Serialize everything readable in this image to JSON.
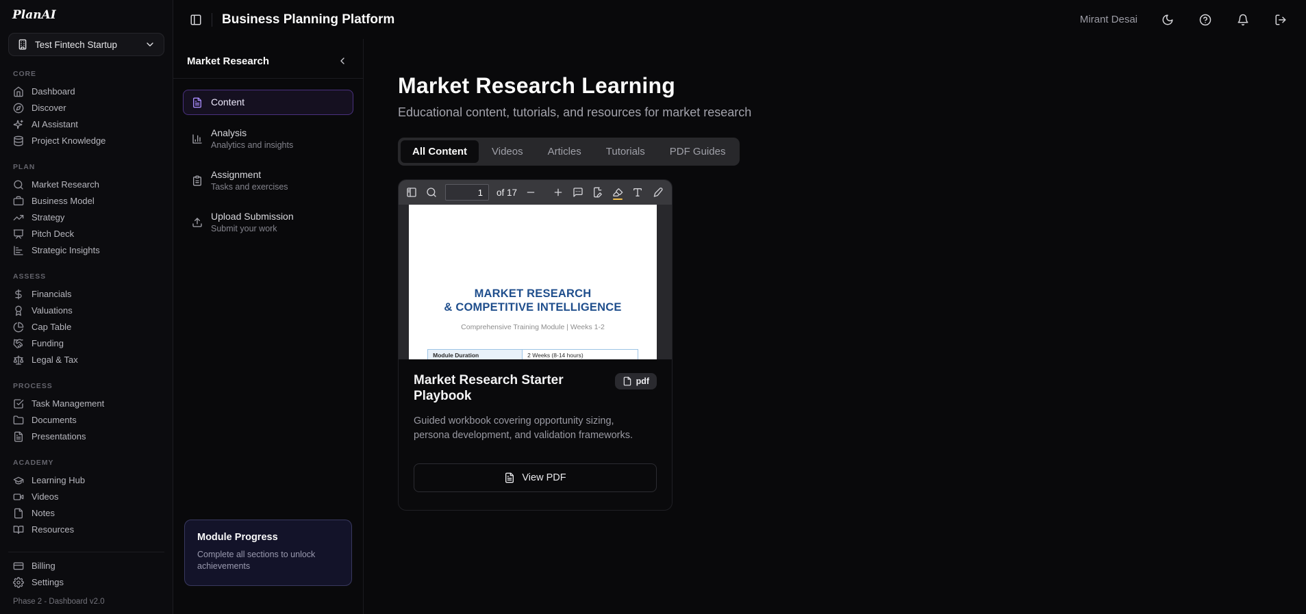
{
  "brand": "PlanAI",
  "workspace": {
    "name": "Test Fintech Startup",
    "icon": "building-icon"
  },
  "sidebar": {
    "sections": [
      {
        "label": "CORE",
        "items": [
          {
            "label": "Dashboard",
            "icon": "home-icon"
          },
          {
            "label": "Discover",
            "icon": "compass-icon"
          },
          {
            "label": "AI Assistant",
            "icon": "sparkles-icon"
          },
          {
            "label": "Project Knowledge",
            "icon": "database-icon"
          }
        ]
      },
      {
        "label": "PLAN",
        "items": [
          {
            "label": "Market Research",
            "icon": "search-icon"
          },
          {
            "label": "Business Model",
            "icon": "briefcase-icon"
          },
          {
            "label": "Strategy",
            "icon": "trending-up-icon"
          },
          {
            "label": "Pitch Deck",
            "icon": "presentation-icon"
          },
          {
            "label": "Strategic Insights",
            "icon": "bar-chart-horizontal-icon"
          }
        ]
      },
      {
        "label": "ASSESS",
        "items": [
          {
            "label": "Financials",
            "icon": "dollar-icon"
          },
          {
            "label": "Valuations",
            "icon": "award-icon"
          },
          {
            "label": "Cap Table",
            "icon": "pie-chart-icon"
          },
          {
            "label": "Funding",
            "icon": "handshake-icon"
          },
          {
            "label": "Legal & Tax",
            "icon": "scale-icon"
          }
        ]
      },
      {
        "label": "PROCESS",
        "items": [
          {
            "label": "Task Management",
            "icon": "check-square-icon"
          },
          {
            "label": "Documents",
            "icon": "folder-icon"
          },
          {
            "label": "Presentations",
            "icon": "file-text-icon"
          }
        ]
      },
      {
        "label": "ACADEMY",
        "items": [
          {
            "label": "Learning Hub",
            "icon": "graduation-cap-icon"
          },
          {
            "label": "Videos",
            "icon": "video-icon"
          },
          {
            "label": "Notes",
            "icon": "file-icon"
          },
          {
            "label": "Resources",
            "icon": "book-open-icon"
          }
        ]
      }
    ],
    "footer_items": [
      {
        "label": "Billing",
        "icon": "credit-card-icon"
      },
      {
        "label": "Settings",
        "icon": "gear-icon"
      }
    ],
    "version": "Phase 2 - Dashboard v2.0"
  },
  "header": {
    "title": "Business Planning Platform",
    "user": "Mirant Desai",
    "icons": [
      "moon-icon",
      "help-circle-icon",
      "bell-icon",
      "logout-icon"
    ]
  },
  "module_panel": {
    "title": "Market Research",
    "items": [
      {
        "label": "Content",
        "sub": "",
        "icon": "file-text-icon",
        "active": true
      },
      {
        "label": "Analysis",
        "sub": "Analytics and insights",
        "icon": "bar-chart-icon",
        "active": false
      },
      {
        "label": "Assignment",
        "sub": "Tasks and exercises",
        "icon": "clipboard-icon",
        "active": false
      },
      {
        "label": "Upload Submission",
        "sub": "Submit your work",
        "icon": "upload-icon",
        "active": false
      }
    ],
    "progress": {
      "title": "Module Progress",
      "subtitle": "Complete all sections to unlock achievements"
    }
  },
  "main": {
    "title": "Market Research Learning",
    "subtitle": "Educational content, tutorials, and resources for market research",
    "tabs": [
      {
        "label": "All Content",
        "active": true
      },
      {
        "label": "Videos",
        "active": false
      },
      {
        "label": "Articles",
        "active": false
      },
      {
        "label": "Tutorials",
        "active": false
      },
      {
        "label": "PDF Guides",
        "active": false
      }
    ],
    "card": {
      "pdf_viewer": {
        "left_icons": [
          "sidebar-toggle-icon",
          "search-icon"
        ],
        "page_value": "1",
        "page_total_label": "of 17",
        "zoom_out_icon": "zoom-out-icon",
        "zoom_in_icon": "zoom-in-icon",
        "annotation_icons": [
          "comment-icon",
          "signature-icon",
          "highlighter-icon",
          "text-tool-icon",
          "pen-icon",
          "image-icon"
        ],
        "doc": {
          "title_line1": "MARKET RESEARCH",
          "title_line2": "& COMPETITIVE INTELLIGENCE",
          "subtitle": "Comprehensive Training Module | Weeks 1-2",
          "table": [
            {
              "label": "Module Duration",
              "value": "2 Weeks (8-14 hours)"
            }
          ]
        }
      },
      "title": "Market Research Starter Playbook",
      "badge": "pdf",
      "badge_icon": "file-icon",
      "description": "Guided workbook covering opportunity sizing, persona development, and validation frameworks.",
      "view_button": "View PDF",
      "view_button_icon": "file-text-icon"
    }
  },
  "colors": {
    "accent_purple": "#a78bfa",
    "doc_heading_blue": "#1f4e8c",
    "table_border_blue": "#9cc3e5",
    "highlighter_yellow": "#f2c04d",
    "background": "#09090b"
  }
}
